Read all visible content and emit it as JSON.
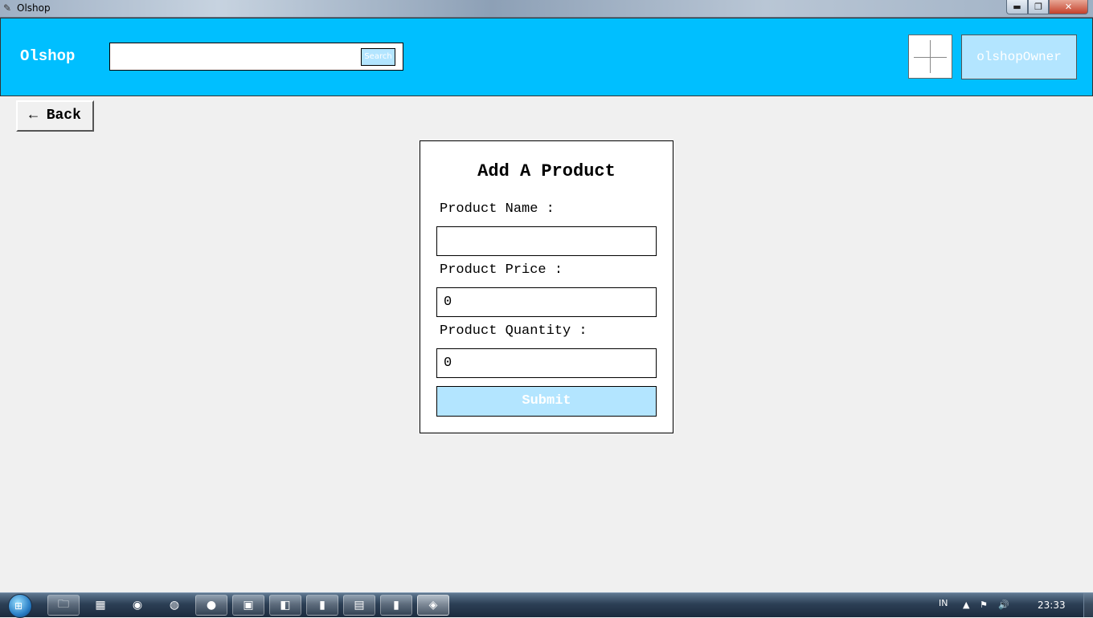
{
  "window": {
    "title": "Olshop",
    "minimize_glyph": "▬",
    "maximize_glyph": "❐",
    "close_glyph": "✕"
  },
  "header": {
    "brand": "Olshop",
    "search": {
      "value": "",
      "button_label": "Search"
    },
    "user_label": "olshopOwner"
  },
  "back_button": {
    "label": "← Back"
  },
  "form": {
    "title": "Add A Product",
    "fields": [
      {
        "label": "Product Name :",
        "value": ""
      },
      {
        "label": "Product Price :",
        "value": "0"
      },
      {
        "label": "Product Quantity :",
        "value": "0"
      }
    ],
    "submit_label": "Submit"
  },
  "taskbar": {
    "items": [
      {
        "name": "file-explorer-icon",
        "glyph": "🗀",
        "state": "open"
      },
      {
        "name": "calculator-icon",
        "glyph": "▦",
        "state": "pinned"
      },
      {
        "name": "torrent-client-icon",
        "glyph": "◉",
        "state": "pinned"
      },
      {
        "name": "obs-icon",
        "glyph": "◍",
        "state": "pinned"
      },
      {
        "name": "firefox-icon",
        "glyph": "●",
        "state": "open"
      },
      {
        "name": "line-chat-icon",
        "glyph": "▣",
        "state": "open"
      },
      {
        "name": "vscode-icon",
        "glyph": "◧",
        "state": "open"
      },
      {
        "name": "app-window-icon",
        "glyph": "▮",
        "state": "open"
      },
      {
        "name": "notepad-icon",
        "glyph": "▤",
        "state": "open"
      },
      {
        "name": "app-window-icon",
        "glyph": "▮",
        "state": "open"
      },
      {
        "name": "python-icon",
        "glyph": "◈",
        "state": "active"
      }
    ],
    "language": "IN",
    "clock": "23:33"
  }
}
